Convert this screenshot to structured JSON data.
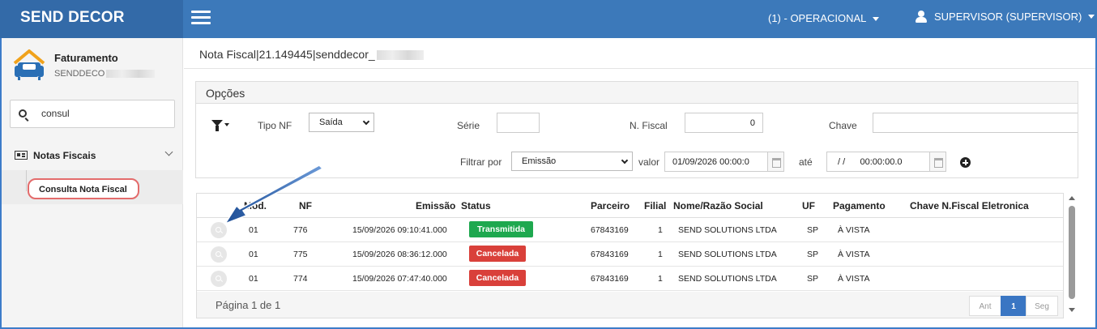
{
  "app": {
    "brand": "SEND DECOR"
  },
  "topbar": {
    "operational": "(1) - OPERACIONAL",
    "user": "SUPERVISOR (SUPERVISOR)"
  },
  "sidebar": {
    "profile_title": "Faturamento",
    "profile_sub": "SENDDECO",
    "search_value": "consul",
    "group_label": "Notas Fiscais",
    "item_label": "Consulta Nota Fiscal"
  },
  "breadcrumb": "Nota Fiscal|21.149445|senddecor_",
  "options": {
    "title": "Opções",
    "tipo_label": "Tipo NF",
    "tipo_value": "Saída",
    "serie_label": "Série",
    "serie_value": "",
    "nfiscal_label": "N. Fiscal",
    "nfiscal_value": "0",
    "chave_label": "Chave",
    "chave_value": "",
    "filtrar_label": "Filtrar por",
    "filtrar_value": "Emissão",
    "valor_label": "valor",
    "valor_value": "01/09/2026 00:00:0",
    "ate_label": "até",
    "ate_value": "/ /      00:00:00.0"
  },
  "table": {
    "headers": [
      "Mod.",
      "NF",
      "Emissão",
      "Status",
      "Parceiro",
      "Filial",
      "Nome/Razão Social",
      "UF",
      "Pagamento",
      "Chave N.Fiscal Eletronica"
    ],
    "rows": [
      {
        "mod": "01",
        "nf": "776",
        "emissao": "15/09/2026 09:10:41.000",
        "status": "Transmitida",
        "parceiro": "67843169",
        "filial": "1",
        "nome": "SEND SOLUTIONS LTDA",
        "uf": "SP",
        "pagamento": "À VISTA",
        "chave": ""
      },
      {
        "mod": "01",
        "nf": "775",
        "emissao": "15/09/2026 08:36:12.000",
        "status": "Cancelada",
        "parceiro": "67843169",
        "filial": "1",
        "nome": "SEND SOLUTIONS LTDA",
        "uf": "SP",
        "pagamento": "À VISTA",
        "chave": ""
      },
      {
        "mod": "01",
        "nf": "774",
        "emissao": "15/09/2026 07:47:40.000",
        "status": "Cancelada",
        "parceiro": "67843169",
        "filial": "1",
        "nome": "SEND SOLUTIONS LTDA",
        "uf": "SP",
        "pagamento": "À VISTA",
        "chave": ""
      }
    ],
    "footer": "Página 1 de 1",
    "pager": {
      "prev": "Ant",
      "current": "1",
      "next": "Seg"
    }
  },
  "colors": {
    "topbar": "#3c79ba",
    "brand_bg": "#336aa8",
    "status_ok": "#1ea84f",
    "status_cancel": "#d9403a",
    "highlight": "#e36b6b"
  },
  "icons": [
    "hamburger-icon",
    "user-icon",
    "search-icon",
    "newspaper-icon",
    "chevron-down-icon",
    "filter-icon",
    "calendar-icon",
    "plus-circle-icon",
    "magnifier-icon",
    "arrow-pointer"
  ]
}
